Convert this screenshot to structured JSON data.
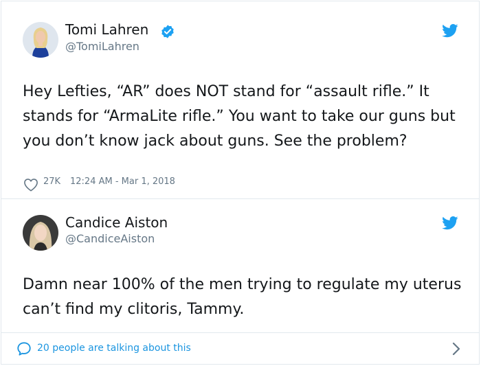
{
  "tweet1": {
    "name": "Tomi Lahren",
    "handle": "@TomiLahren",
    "text": "Hey Lefties, “AR” does NOT stand for “assault rifle.” It stands for “ArmaLite rifle.” You want to take our guns but you don’t know jack about guns. See the problem?",
    "likes": "27K",
    "timestamp": "12:24 AM - Mar 1, 2018",
    "verified": true
  },
  "tweet2": {
    "name": "Candice Aiston",
    "handle": "@CandiceAiston",
    "text": "Damn near 100% of the men trying to regulate my uterus can’t find my clitoris, Tammy."
  },
  "footer": {
    "talking_label": "20 people are talking about this"
  },
  "icons": {
    "verified": "verified-badge-icon",
    "twitter": "twitter-bird-icon",
    "like": "heart-icon",
    "reply": "speech-bubble-icon",
    "more": "chevron-right-icon"
  },
  "colors": {
    "twitter_blue": "#1da1f2",
    "link_blue": "#1b95e0",
    "secondary_text": "#657786",
    "border": "#e1e8ed"
  }
}
